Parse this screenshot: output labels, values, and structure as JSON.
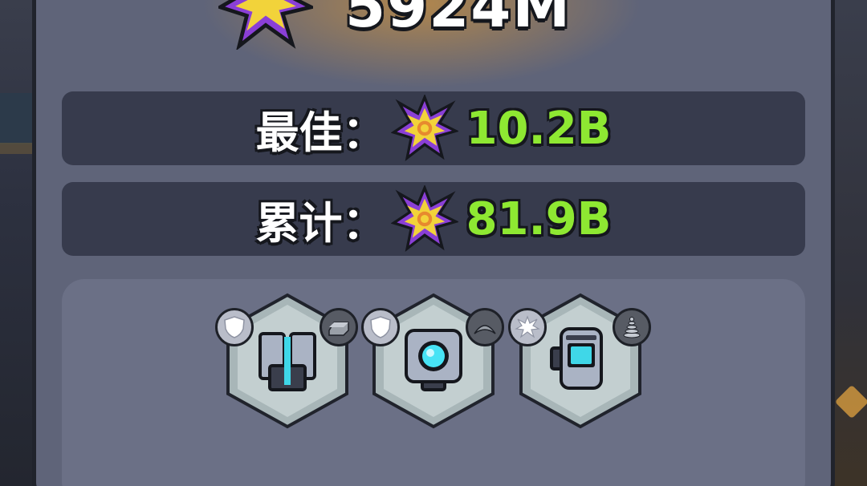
{
  "score": {
    "value": "5924M"
  },
  "best": {
    "label": "最佳：",
    "value": "10.2B"
  },
  "total": {
    "label": "累计：",
    "value": "81.9B"
  },
  "colors": {
    "value_green": "#8ee832",
    "panel": "#5f6479",
    "row": "#373b4d",
    "burst_purple": "#8a3fd6",
    "burst_yellow": "#f2d33a"
  },
  "equipment": [
    {
      "item_icon": "armor-plates-icon",
      "left_badge_icon": "shield-icon",
      "right_badge_icon": "ingot-icon"
    },
    {
      "item_icon": "cyan-core-module-icon",
      "left_badge_icon": "shield-icon",
      "right_badge_icon": "arc-icon"
    },
    {
      "item_icon": "canister-module-icon",
      "left_badge_icon": "burst-icon",
      "right_badge_icon": "spring-icon"
    }
  ]
}
